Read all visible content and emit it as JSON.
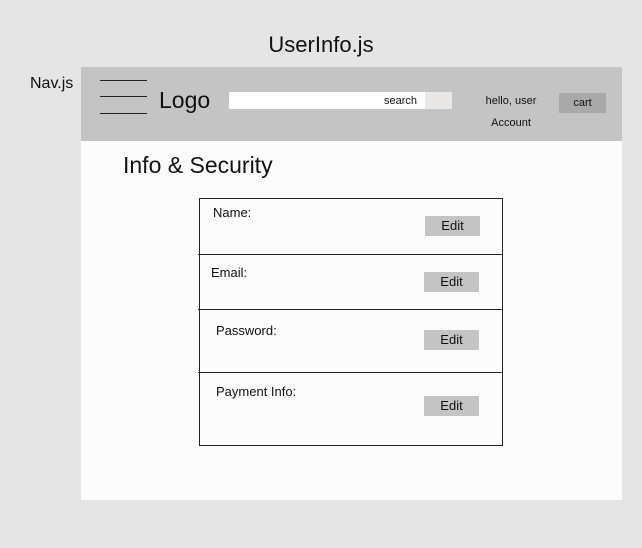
{
  "file_title": "UserInfo.js",
  "nav_label": "Nav.js",
  "navbar": {
    "logo": "Logo",
    "search_placeholder": "search",
    "greeting_line1": "hello, user",
    "greeting_line2": "Account",
    "cart_label": "cart"
  },
  "page": {
    "title": "Info & Security",
    "fields": [
      {
        "label": "Name:",
        "action": "Edit"
      },
      {
        "label": "Email:",
        "action": "Edit"
      },
      {
        "label": "Password:",
        "action": "Edit"
      },
      {
        "label": "Payment Info:",
        "action": "Edit"
      }
    ]
  },
  "colors": {
    "background": "#e5e5e5",
    "navbar": "#c4c4c4",
    "content": "#fdfcfc",
    "edit_button": "#c4c4c4",
    "cart_button": "#a9a9a9"
  }
}
